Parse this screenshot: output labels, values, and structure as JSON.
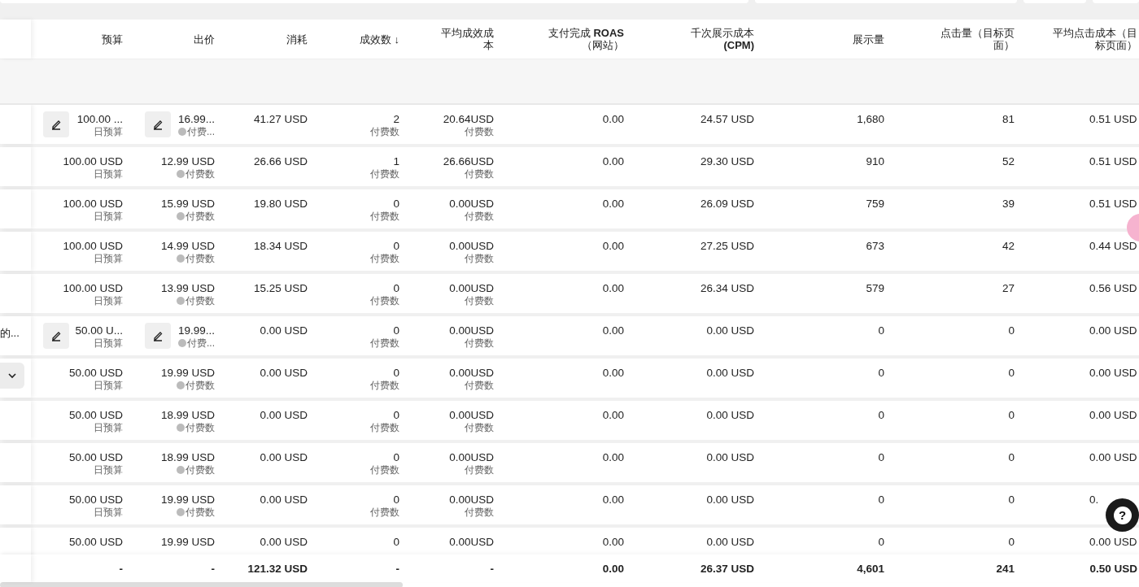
{
  "columns": [
    {
      "label": "预算"
    },
    {
      "label": "出价"
    },
    {
      "label": "消耗"
    },
    {
      "label": "成效数",
      "sort_arrow": "↓"
    },
    {
      "label": "平均成效成本"
    },
    {
      "label": "支付完成 **ROAS**（网站）"
    },
    {
      "label": "千次展示成本**(CPM)**"
    },
    {
      "label": "展示量"
    },
    {
      "label": "点击量（目标页面）"
    },
    {
      "label": "平均点击成本（目标页面）"
    }
  ],
  "rows": [
    {
      "name": "",
      "dropdown": false,
      "budget": {
        "value": "100.00 ...",
        "sub": "日预算",
        "editable": true
      },
      "bid": {
        "value": "16.99...",
        "sub": "付费...",
        "editable": true
      },
      "spend": "41.27 USD",
      "results": "2",
      "results_sub": "付费数",
      "avg_cost": "20.64USD",
      "avg_sub": "付费数",
      "roas": "0.00",
      "cpm": "24.57 USD",
      "impressions": "1,680",
      "clicks": "81",
      "cpc": "0.51 USD"
    },
    {
      "name": "",
      "dropdown": false,
      "budget": {
        "value": "100.00 USD",
        "sub": "日预算",
        "editable": false
      },
      "bid": {
        "value": "12.99 USD",
        "sub": "付费数",
        "editable": false
      },
      "spend": "26.66 USD",
      "results": "1",
      "results_sub": "付费数",
      "avg_cost": "26.66USD",
      "avg_sub": "付费数",
      "roas": "0.00",
      "cpm": "29.30 USD",
      "impressions": "910",
      "clicks": "52",
      "cpc": "0.51 USD"
    },
    {
      "name": "",
      "dropdown": false,
      "budget": {
        "value": "100.00 USD",
        "sub": "日预算",
        "editable": false
      },
      "bid": {
        "value": "15.99 USD",
        "sub": "付费数",
        "editable": false
      },
      "spend": "19.80 USD",
      "results": "0",
      "results_sub": "付费数",
      "avg_cost": "0.00USD",
      "avg_sub": "付费数",
      "roas": "0.00",
      "cpm": "26.09 USD",
      "impressions": "759",
      "clicks": "39",
      "cpc": "0.51 USD"
    },
    {
      "name": "",
      "dropdown": false,
      "budget": {
        "value": "100.00 USD",
        "sub": "日预算",
        "editable": false
      },
      "bid": {
        "value": "14.99 USD",
        "sub": "付费数",
        "editable": false
      },
      "spend": "18.34 USD",
      "results": "0",
      "results_sub": "付费数",
      "avg_cost": "0.00USD",
      "avg_sub": "付费数",
      "roas": "0.00",
      "cpm": "27.25 USD",
      "impressions": "673",
      "clicks": "42",
      "cpc": "0.44 USD"
    },
    {
      "name": "",
      "dropdown": false,
      "budget": {
        "value": "100.00 USD",
        "sub": "日预算",
        "editable": false
      },
      "bid": {
        "value": "13.99 USD",
        "sub": "付费数",
        "editable": false
      },
      "spend": "15.25 USD",
      "results": "0",
      "results_sub": "付费数",
      "avg_cost": "0.00USD",
      "avg_sub": "付费数",
      "roas": "0.00",
      "cpm": "26.34 USD",
      "impressions": "579",
      "clicks": "27",
      "cpc": "0.56 USD"
    },
    {
      "name": "的...",
      "dropdown": false,
      "budget": {
        "value": "50.00 U...",
        "sub": "日预算",
        "editable": true
      },
      "bid": {
        "value": "19.99...",
        "sub": "付费...",
        "editable": true
      },
      "spend": "0.00 USD",
      "results": "0",
      "results_sub": "付费数",
      "avg_cost": "0.00USD",
      "avg_sub": "付费数",
      "roas": "0.00",
      "cpm": "0.00 USD",
      "impressions": "0",
      "clicks": "0",
      "cpc": "0.00 USD"
    },
    {
      "name": "",
      "dropdown": true,
      "budget": {
        "value": "50.00 USD",
        "sub": "日预算",
        "editable": false
      },
      "bid": {
        "value": "19.99 USD",
        "sub": "付费数",
        "editable": false
      },
      "spend": "0.00 USD",
      "results": "0",
      "results_sub": "付费数",
      "avg_cost": "0.00USD",
      "avg_sub": "付费数",
      "roas": "0.00",
      "cpm": "0.00 USD",
      "impressions": "0",
      "clicks": "0",
      "cpc": "0.00 USD"
    },
    {
      "name": "",
      "dropdown": false,
      "budget": {
        "value": "50.00 USD",
        "sub": "日预算",
        "editable": false
      },
      "bid": {
        "value": "18.99 USD",
        "sub": "付费数",
        "editable": false
      },
      "spend": "0.00 USD",
      "results": "0",
      "results_sub": "付费数",
      "avg_cost": "0.00USD",
      "avg_sub": "付费数",
      "roas": "0.00",
      "cpm": "0.00 USD",
      "impressions": "0",
      "clicks": "0",
      "cpc": "0.00 USD"
    },
    {
      "name": "",
      "dropdown": false,
      "budget": {
        "value": "50.00 USD",
        "sub": "日预算",
        "editable": false
      },
      "bid": {
        "value": "18.99 USD",
        "sub": "付费数",
        "editable": false
      },
      "spend": "0.00 USD",
      "results": "0",
      "results_sub": "付费数",
      "avg_cost": "0.00USD",
      "avg_sub": "付费数",
      "roas": "0.00",
      "cpm": "0.00 USD",
      "impressions": "0",
      "clicks": "0",
      "cpc": "0.00 USD"
    },
    {
      "name": "",
      "dropdown": false,
      "budget": {
        "value": "50.00 USD",
        "sub": "日预算",
        "editable": false
      },
      "bid": {
        "value": "19.99 USD",
        "sub": "付费数",
        "editable": false
      },
      "spend": "0.00 USD",
      "results": "0",
      "results_sub": "付费数",
      "avg_cost": "0.00USD",
      "avg_sub": "付费数",
      "roas": "0.00",
      "cpm": "0.00 USD",
      "impressions": "0",
      "clicks": "0",
      "cpc": "0."
    },
    {
      "name": "",
      "dropdown": false,
      "budget": {
        "value": "50.00 USD",
        "editable": false
      },
      "bid": {
        "value": "19.99 USD",
        "editable": false
      },
      "spend": "0.00 USD",
      "results": "0",
      "avg_cost": "0.00USD",
      "roas": "0.00",
      "cpm": "0.00 USD",
      "impressions": "0",
      "clicks": "0",
      "cpc": "0.00 USD"
    }
  ],
  "totals": [
    "-",
    "-",
    "121.32 USD",
    "-",
    "-",
    "0.00",
    "26.37 USD",
    "4,601",
    "241",
    "0.50 USD"
  ],
  "help_button": {
    "label": "?"
  }
}
